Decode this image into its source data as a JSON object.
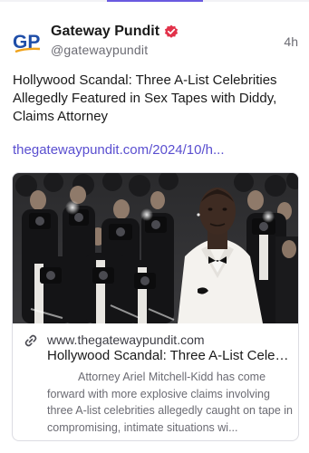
{
  "post": {
    "author": {
      "display_name": "Gateway Pundit",
      "handle": "@gatewaypundit",
      "avatar_icon": "gp-logo-icon",
      "verified_icon": "verified-badge-icon"
    },
    "timestamp": "4h",
    "text": "Hollywood Scandal: Three A-List Celebrities Allegedly Featured in Sex Tapes with Diddy, Claims Attorney",
    "link_text": "thegatewaypundit.com/2024/10/h..."
  },
  "link_card": {
    "image_icon": "celebrity-photo-image",
    "link_icon": "chain-link-icon",
    "domain": "www.thegatewaypundit.com",
    "title": "Hollywood Scandal: Three A-List Celebrities Allegedly Featured in Sex Tapes with Diddy, Claims Attorney",
    "description": "Attorney Ariel Mitchell-Kidd has come forward with more explosive claims involving three A-list celebrities allegedly caught on tape in compromising, intimate situations wi..."
  },
  "colors": {
    "accent": "#6a5ae0",
    "link": "#5a4fd0",
    "brand_blue": "#1f4ea8",
    "brand_orange": "#f0a21a",
    "verified_red": "#e2324a"
  }
}
